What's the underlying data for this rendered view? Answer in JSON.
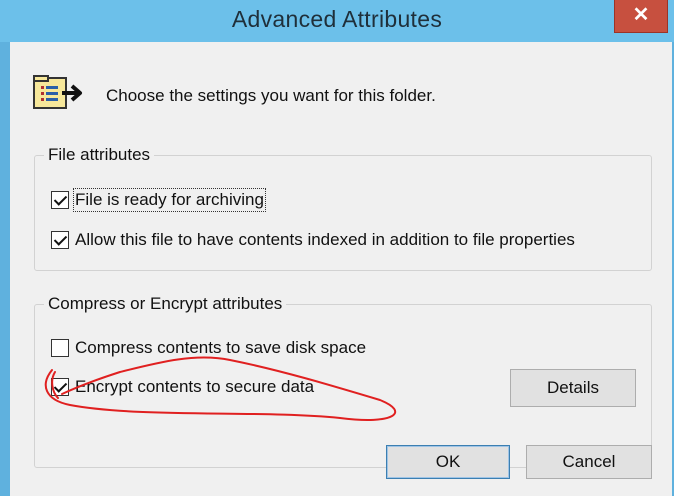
{
  "window": {
    "title": "Advanced Attributes",
    "close_glyph": "✕"
  },
  "header": {
    "icon": "folder-properties-icon",
    "text": "Choose the settings you want for this folder."
  },
  "file_attributes": {
    "legend": "File attributes",
    "items": [
      {
        "label": "File is ready for archiving",
        "checked": true
      },
      {
        "label": "Allow this file to have contents indexed in addition to file properties",
        "checked": true
      }
    ]
  },
  "compress_encrypt": {
    "legend": "Compress or Encrypt attributes",
    "items": [
      {
        "label": "Compress contents to save disk space",
        "checked": false
      },
      {
        "label": "Encrypt contents to secure data",
        "checked": true
      }
    ],
    "details_label": "Details"
  },
  "buttons": {
    "ok": "OK",
    "cancel": "Cancel"
  },
  "colors": {
    "titlebar": "#6cc0ea",
    "close": "#c7503f",
    "annotation": "#e02020"
  }
}
